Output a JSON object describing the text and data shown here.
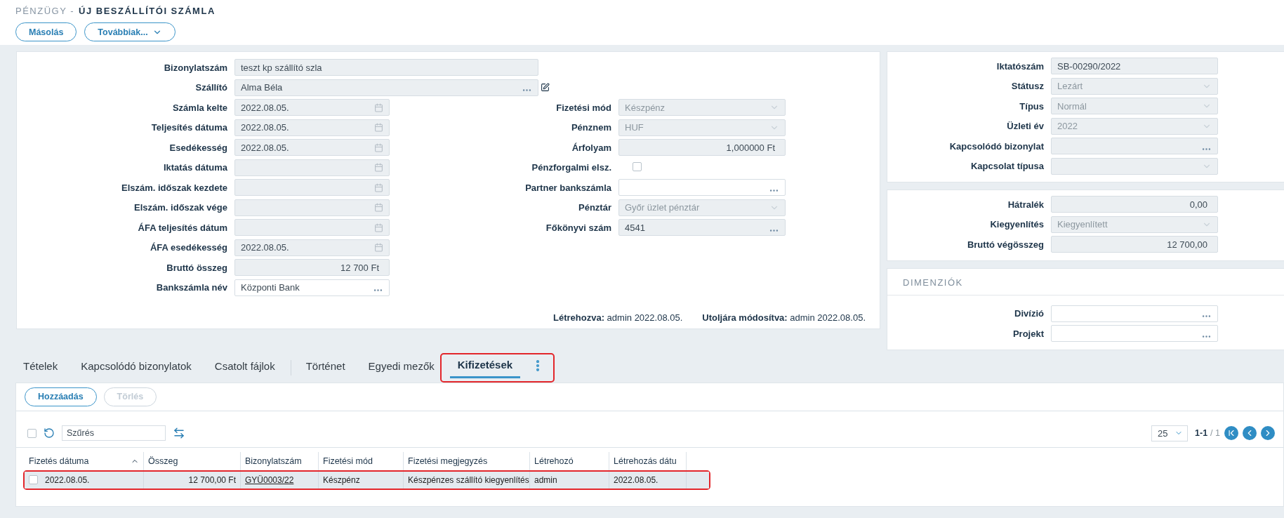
{
  "breadcrumb": {
    "section": "PÉNZÜGY -",
    "title": "ÚJ BESZÁLLÍTÓI SZÁMLA"
  },
  "actions": [
    {
      "label": "Másolás"
    },
    {
      "label": "Továbbiak...",
      "dropdown": true
    }
  ],
  "main_form": {
    "wide_fields": [
      {
        "label": "Bizonylatszám",
        "kind": "text",
        "value": "teszt kp szállító szla",
        "readonly": true
      },
      {
        "label": "Szállító",
        "kind": "lookup",
        "value": "Alma Béla",
        "readonly": true,
        "editable": true
      }
    ],
    "left_fields": [
      {
        "label": "Számla kelte",
        "kind": "date",
        "value": "2022.08.05.",
        "readonly": true
      },
      {
        "label": "Teljesítés dátuma",
        "kind": "date",
        "value": "2022.08.05.",
        "readonly": true
      },
      {
        "label": "Esedékesség",
        "kind": "date",
        "value": "2022.08.05.",
        "readonly": true
      },
      {
        "label": "Iktatás dátuma",
        "kind": "date",
        "readonly": true
      },
      {
        "label": "Elszám. időszak kezdete",
        "kind": "date",
        "readonly": true
      },
      {
        "label": "Elszám. időszak vége",
        "kind": "date",
        "readonly": true
      },
      {
        "label": "ÁFA teljesítés dátum",
        "kind": "date",
        "readonly": true
      },
      {
        "label": "ÁFA esedékesség",
        "kind": "date",
        "value": "2022.08.05.",
        "readonly": true
      },
      {
        "label": "Bruttó összeg",
        "kind": "number",
        "value": "12 700 Ft",
        "readonly": true
      },
      {
        "label": "Bankszámla név",
        "kind": "lookup",
        "value": "Központi Bank",
        "readonly": false
      }
    ],
    "right_fields": [
      {
        "label": "Fizetési mód",
        "kind": "select",
        "value": "Készpénz",
        "readonly": true
      },
      {
        "label": "Pénznem",
        "kind": "select",
        "value": "HUF",
        "readonly": true
      },
      {
        "label": "Árfolyam",
        "kind": "number",
        "value": "1,000000 Ft",
        "readonly": true
      },
      {
        "label": "Pénzforgalmi elsz.",
        "kind": "checkbox",
        "checked": false
      },
      {
        "label": "Partner bankszámla",
        "kind": "lookup",
        "readonly": false
      },
      {
        "label": "Pénztár",
        "kind": "select",
        "value": "Győr üzlet pénztár",
        "readonly": true
      },
      {
        "label": "Főkönyvi szám",
        "kind": "lookup",
        "value": "4541",
        "readonly": true
      }
    ],
    "footer": [
      {
        "label": "Létrehozva:",
        "value": "admin 2022.08.05."
      },
      {
        "label": "Utoljára módosítva:",
        "value": "admin 2022.08.05."
      }
    ]
  },
  "side_panels": [
    {
      "fields": [
        {
          "label": "Iktatószám",
          "kind": "text",
          "value": "SB-00290/2022",
          "readonly": true
        },
        {
          "label": "Státusz",
          "kind": "select",
          "value": "Lezárt",
          "readonly": true
        },
        {
          "label": "Típus",
          "kind": "select",
          "value": "Normál",
          "readonly": true
        },
        {
          "label": "Üzleti év",
          "kind": "select",
          "value": "2022",
          "readonly": true
        },
        {
          "label": "Kapcsolódó bizonylat",
          "kind": "lookup",
          "readonly": true
        },
        {
          "label": "Kapcsolat típusa",
          "kind": "select",
          "readonly": true
        }
      ]
    },
    {
      "fields": [
        {
          "label": "Hátralék",
          "kind": "number",
          "value": "0,00",
          "readonly": true
        },
        {
          "label": "Kiegyenlítés",
          "kind": "select",
          "value": "Kiegyenlített",
          "readonly": true
        },
        {
          "label": "Bruttó végösszeg",
          "kind": "number",
          "value": "12 700,00",
          "readonly": true
        }
      ]
    },
    {
      "title": "DIMENZIÓK",
      "fields": [
        {
          "label": "Divízió",
          "kind": "lookup",
          "readonly": false
        },
        {
          "label": "Projekt",
          "kind": "lookup",
          "readonly": false
        }
      ]
    }
  ],
  "tabs": [
    {
      "label": "Tételek",
      "selected": false
    },
    {
      "label": "Kapcsolódó bizonylatok",
      "selected": false
    },
    {
      "label": "Csatolt fájlok",
      "selected": false,
      "divider_after": true
    },
    {
      "label": "Történet",
      "selected": false
    },
    {
      "label": "Egyedi mezők",
      "selected": false
    },
    {
      "label": "Kifizetések",
      "selected": true
    }
  ],
  "tabs_annotated": true,
  "tab_buttons": [
    {
      "label": "Hozzáadás",
      "disabled": false
    },
    {
      "label": "Törlés",
      "disabled": true
    }
  ],
  "toolbar": {
    "select_all": false,
    "filter_placeholder": "Szűrés",
    "page_size": "25",
    "range": "1-1",
    "total": "/ 1"
  },
  "table": {
    "columns": [
      {
        "label": "Fizetés dátuma",
        "kind": "date",
        "sorted": true
      },
      {
        "label": "Összeg",
        "kind": "amount"
      },
      {
        "label": "Bizonylatszám",
        "kind": "link"
      },
      {
        "label": "Fizetési mód",
        "kind": "text"
      },
      {
        "label": "Fizetési megjegyzés",
        "kind": "text"
      },
      {
        "label": "Létrehozó",
        "kind": "text"
      },
      {
        "label": "Létrehozás dátu",
        "kind": "text"
      }
    ],
    "rows": [
      {
        "checked": false,
        "annotated": true,
        "cells": [
          "2022.08.05.",
          "12 700,00 Ft",
          "GYÜ0003/22",
          "Készpénz",
          "Készpénzes szállító kiegyenlítés",
          "admin",
          "2022.08.05."
        ]
      }
    ]
  }
}
